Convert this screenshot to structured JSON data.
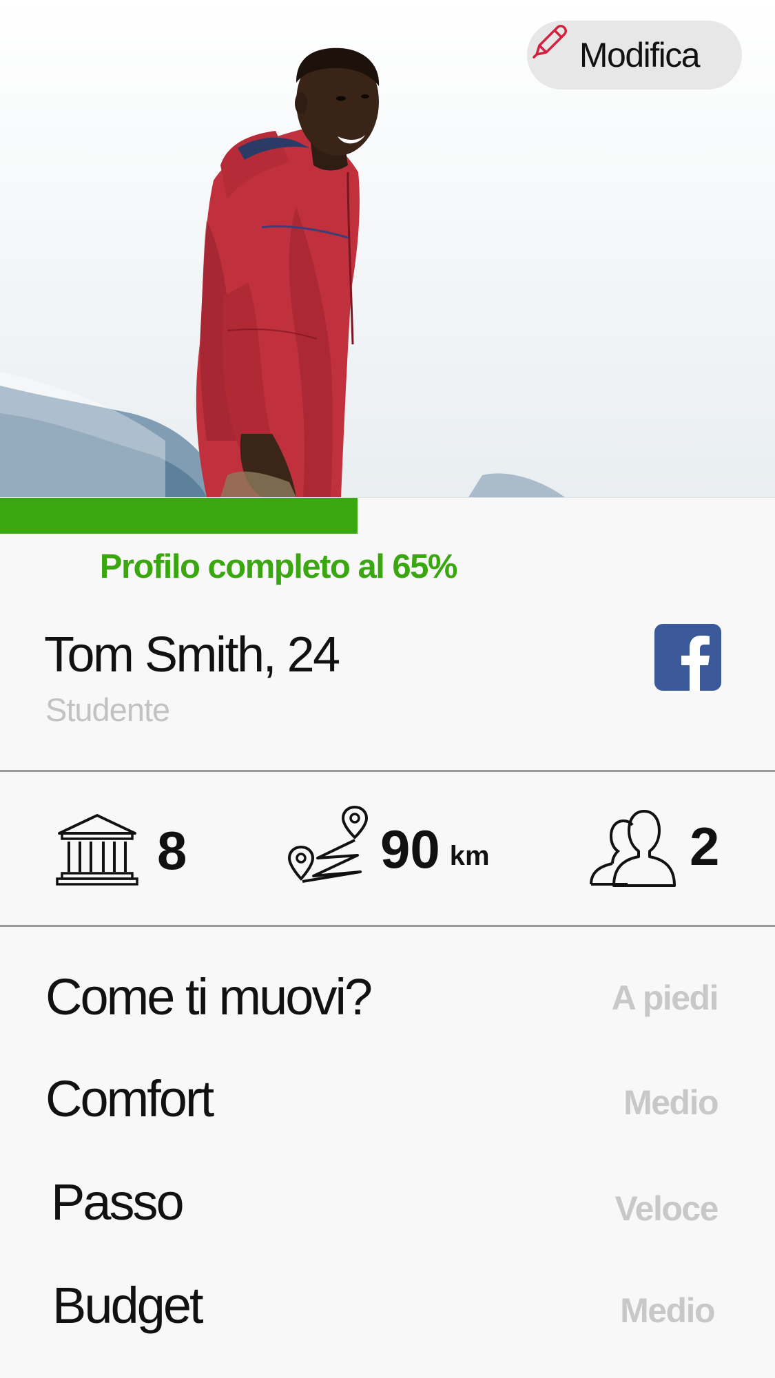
{
  "header": {
    "edit_label": "Modifica",
    "edit_icon": "pencil-icon",
    "photo": "profile-cover-photo"
  },
  "profile": {
    "completion_percent": 65,
    "completion_label": "Profilo completo al 65%",
    "name": "Tom Smith, 24",
    "occupation": "Studente",
    "social_icon": "facebook-icon"
  },
  "stats": [
    {
      "icon": "museum-icon",
      "value": "8",
      "unit": ""
    },
    {
      "icon": "route-icon",
      "value": "90",
      "unit": "km"
    },
    {
      "icon": "friends-icon",
      "value": "2",
      "unit": ""
    }
  ],
  "preferences": [
    {
      "label": "Come ti muovi?",
      "value": "A piedi"
    },
    {
      "label": "Comfort",
      "value": "Medio"
    },
    {
      "label": "Passo",
      "value": "Veloce"
    },
    {
      "label": "Budget",
      "value": "Medio"
    }
  ],
  "colors": {
    "accent_green": "#3aa711",
    "facebook_blue": "#3b5998",
    "muted_text": "#c2c2c2"
  }
}
